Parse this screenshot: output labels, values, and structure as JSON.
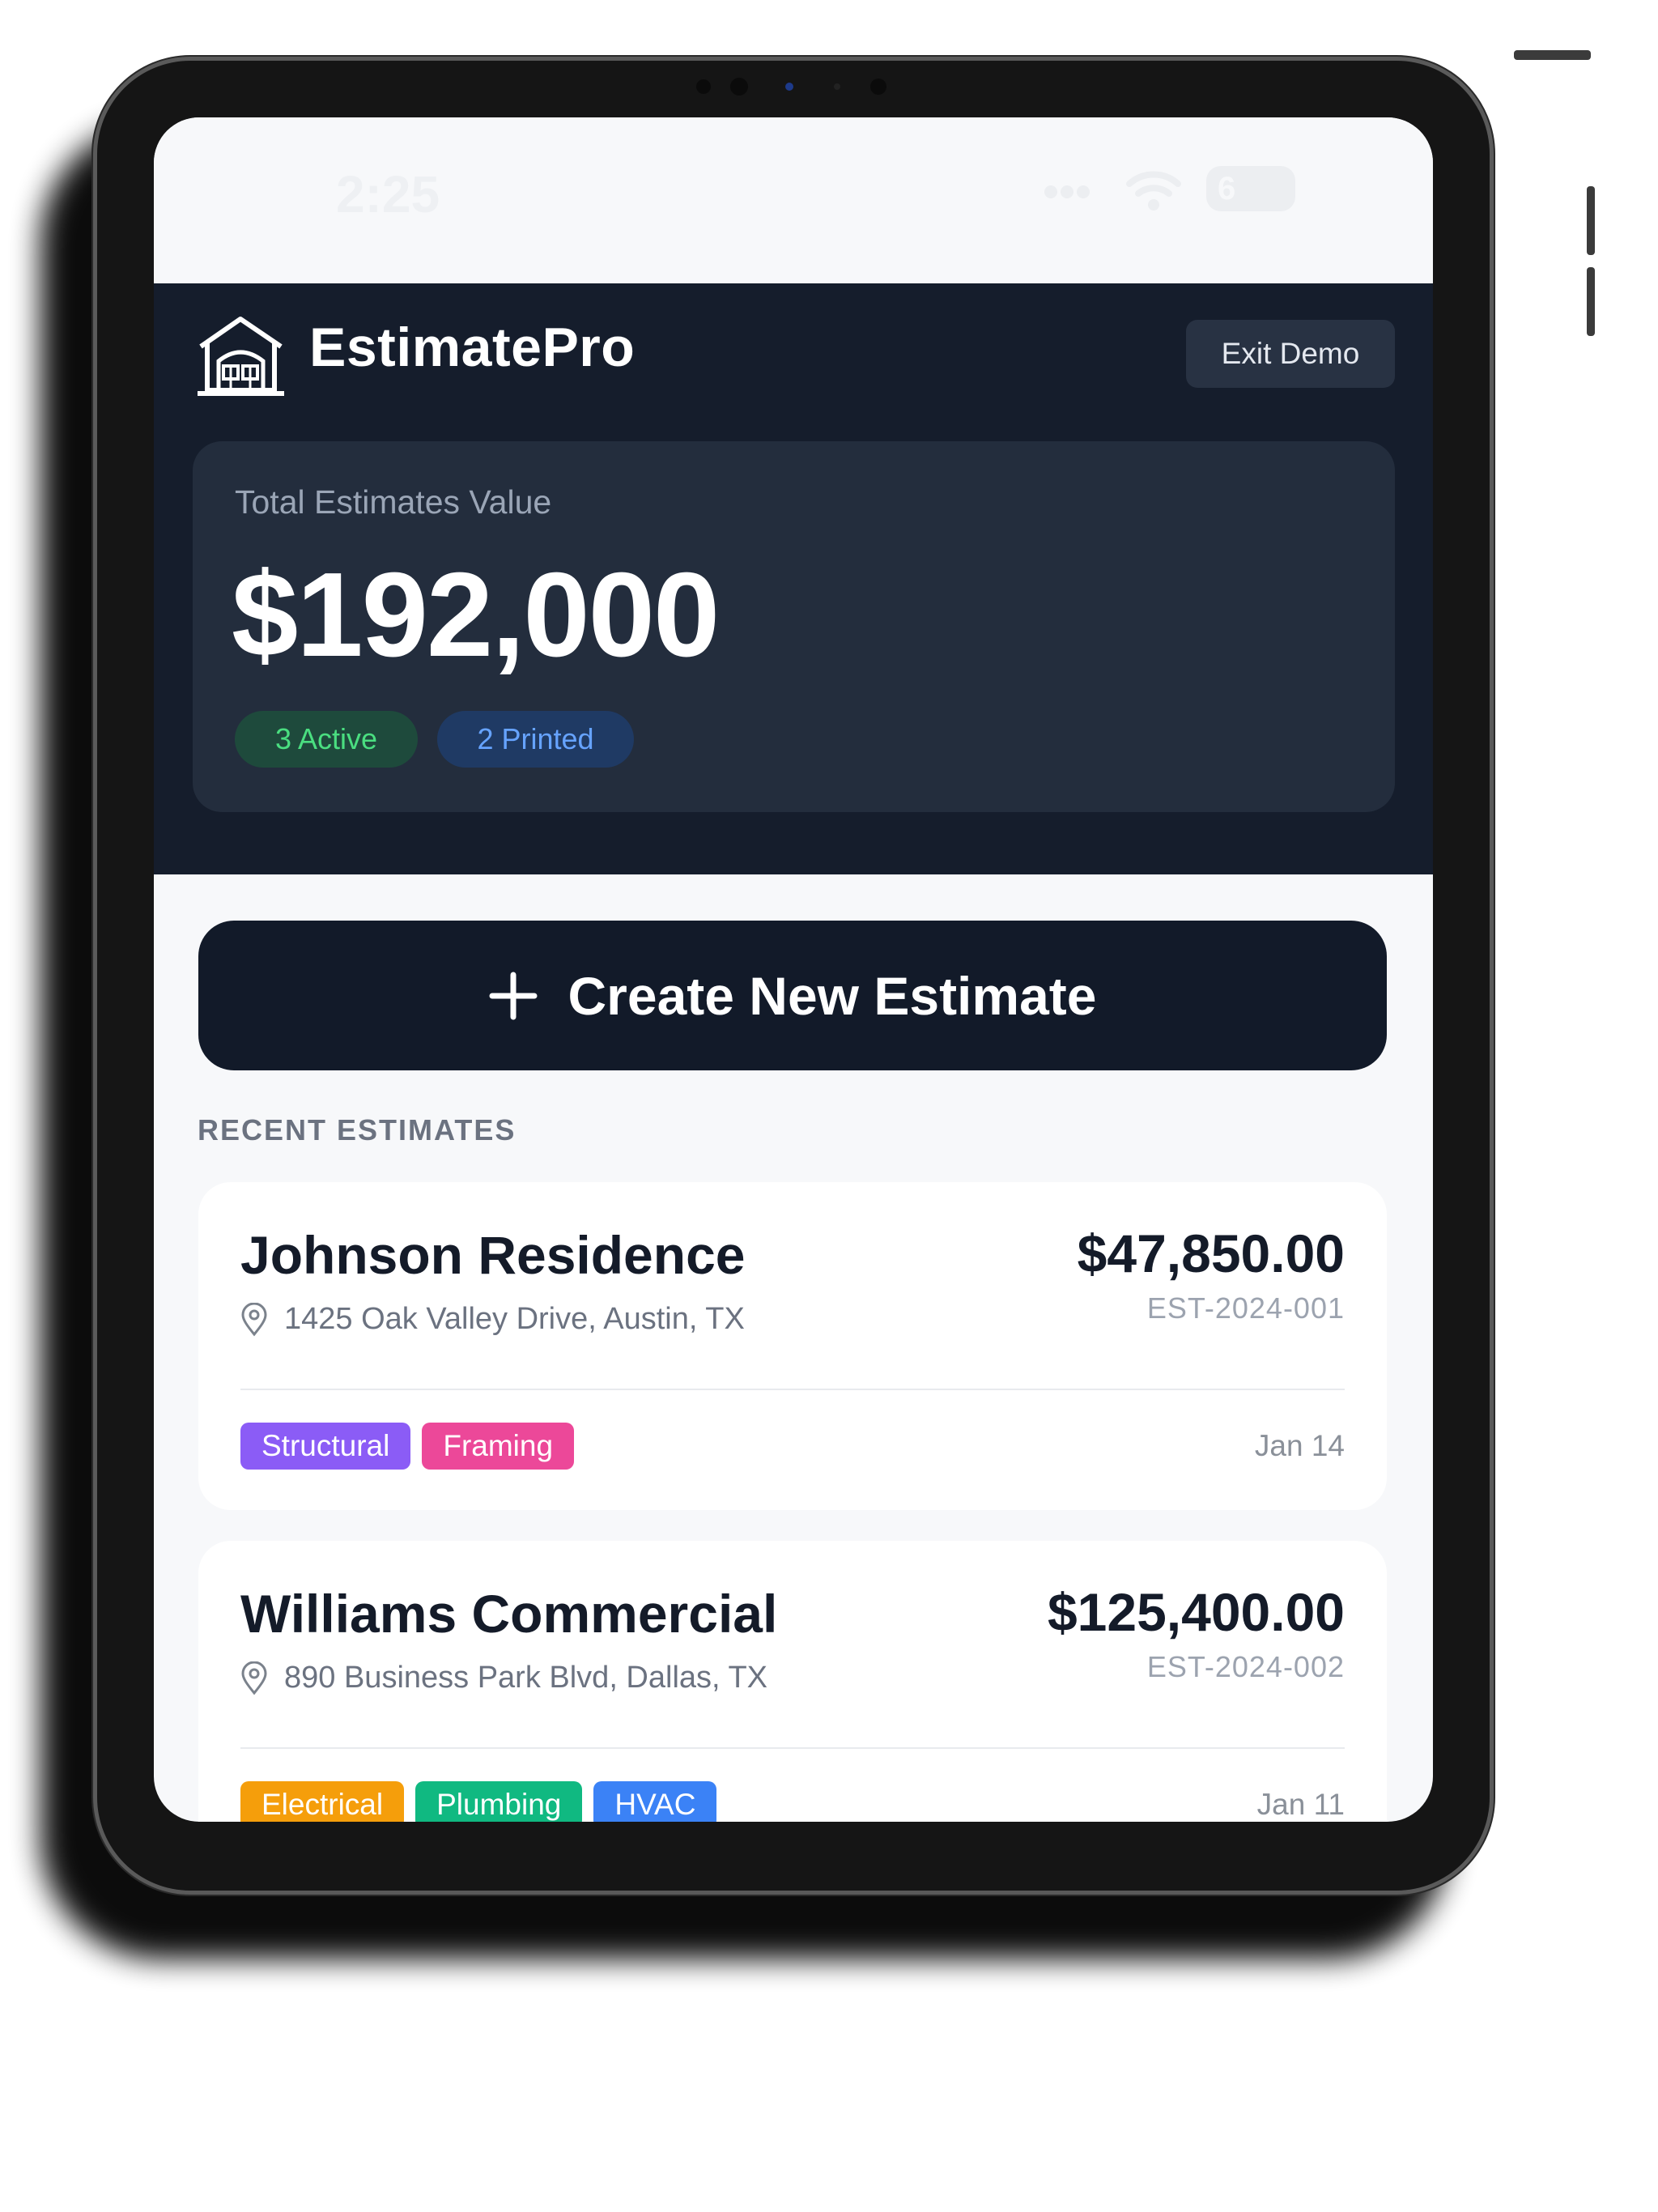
{
  "status_bar": {
    "time": "2:25",
    "battery": "6"
  },
  "app": {
    "title": "EstimatePro",
    "exit_label": "Exit Demo"
  },
  "summary": {
    "label": "Total Estimates Value",
    "value": "$192,000",
    "badges": {
      "active": "3 Active",
      "printed": "2 Printed"
    }
  },
  "create_button": {
    "label": "Create New Estimate"
  },
  "recent": {
    "title": "RECENT ESTIMATES",
    "items": [
      {
        "name": "Johnson Residence",
        "address": "1425 Oak Valley Drive, Austin, TX",
        "amount": "$47,850.00",
        "id": "EST-2024-001",
        "date": "Jan 14",
        "tags": [
          {
            "label": "Structural",
            "color": "#8b5cf6"
          },
          {
            "label": "Framing",
            "color": "#ec4899"
          }
        ]
      },
      {
        "name": "Williams Commercial",
        "address": "890 Business Park Blvd, Dallas, TX",
        "amount": "$125,400.00",
        "id": "EST-2024-002",
        "date": "Jan 11",
        "tags": [
          {
            "label": "Electrical",
            "color": "#f59e0b"
          },
          {
            "label": "Plumbing",
            "color": "#10b981"
          },
          {
            "label": "HVAC",
            "color": "#3b82f6"
          }
        ]
      }
    ]
  },
  "colors": {
    "header_bg": "#151d2c",
    "card_bg": "#232d3d",
    "primary_button": "#121a29",
    "active_green": "#4ade80",
    "printed_blue": "#66a3ff"
  }
}
